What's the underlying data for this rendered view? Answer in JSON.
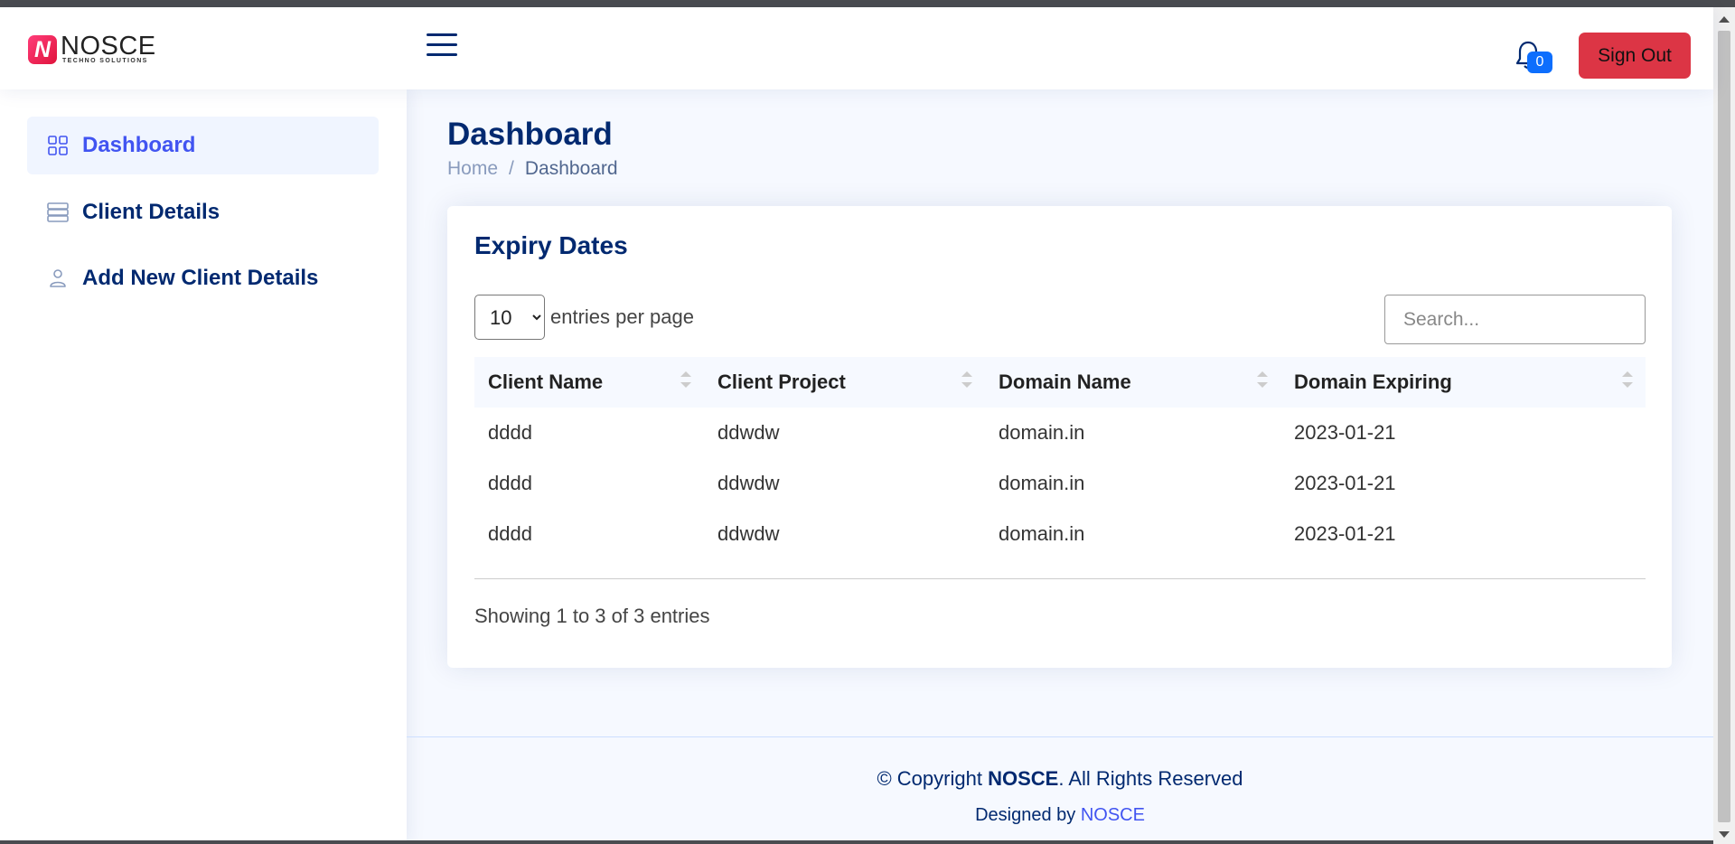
{
  "brand": {
    "name": "NOSCE",
    "tagline": "TECHNO SOLUTIONS",
    "mark": "N"
  },
  "header": {
    "notifications": {
      "icon": "bell-icon",
      "count": "0"
    },
    "signout_label": "Sign Out"
  },
  "sidebar": {
    "items": [
      {
        "label": "Dashboard",
        "icon": "grid-icon",
        "active": true
      },
      {
        "label": "Client Details",
        "icon": "list-icon",
        "active": false
      },
      {
        "label": "Add New Client Details",
        "icon": "person-icon",
        "active": false
      }
    ]
  },
  "main": {
    "title": "Dashboard",
    "breadcrumb": {
      "home": "Home",
      "separator": "/",
      "current": "Dashboard"
    },
    "card": {
      "title": "Expiry Dates",
      "per_page": {
        "value": "10",
        "options": [
          "10"
        ],
        "label": "entries per page"
      },
      "search": {
        "placeholder": "Search...",
        "value": ""
      },
      "columns": [
        "Client Name",
        "Client Project",
        "Domain Name",
        "Domain Expiring"
      ],
      "rows": [
        [
          "dddd",
          "ddwdw",
          "domain.in",
          "2023-01-21"
        ],
        [
          "dddd",
          "ddwdw",
          "domain.in",
          "2023-01-21"
        ],
        [
          "dddd",
          "ddwdw",
          "domain.in",
          "2023-01-21"
        ]
      ],
      "info": "Showing 1 to 3 of 3 entries"
    }
  },
  "footer": {
    "copyright_prefix": "© Copyright ",
    "copyright_brand": "NOSCE",
    "copyright_suffix": ". All Rights Reserved",
    "designed_by": "Designed by ",
    "designer": "NOSCE"
  },
  "colors": {
    "primary": "#012970",
    "accent": "#4154f1",
    "danger": "#dc3545",
    "badge": "#0d6efd"
  }
}
